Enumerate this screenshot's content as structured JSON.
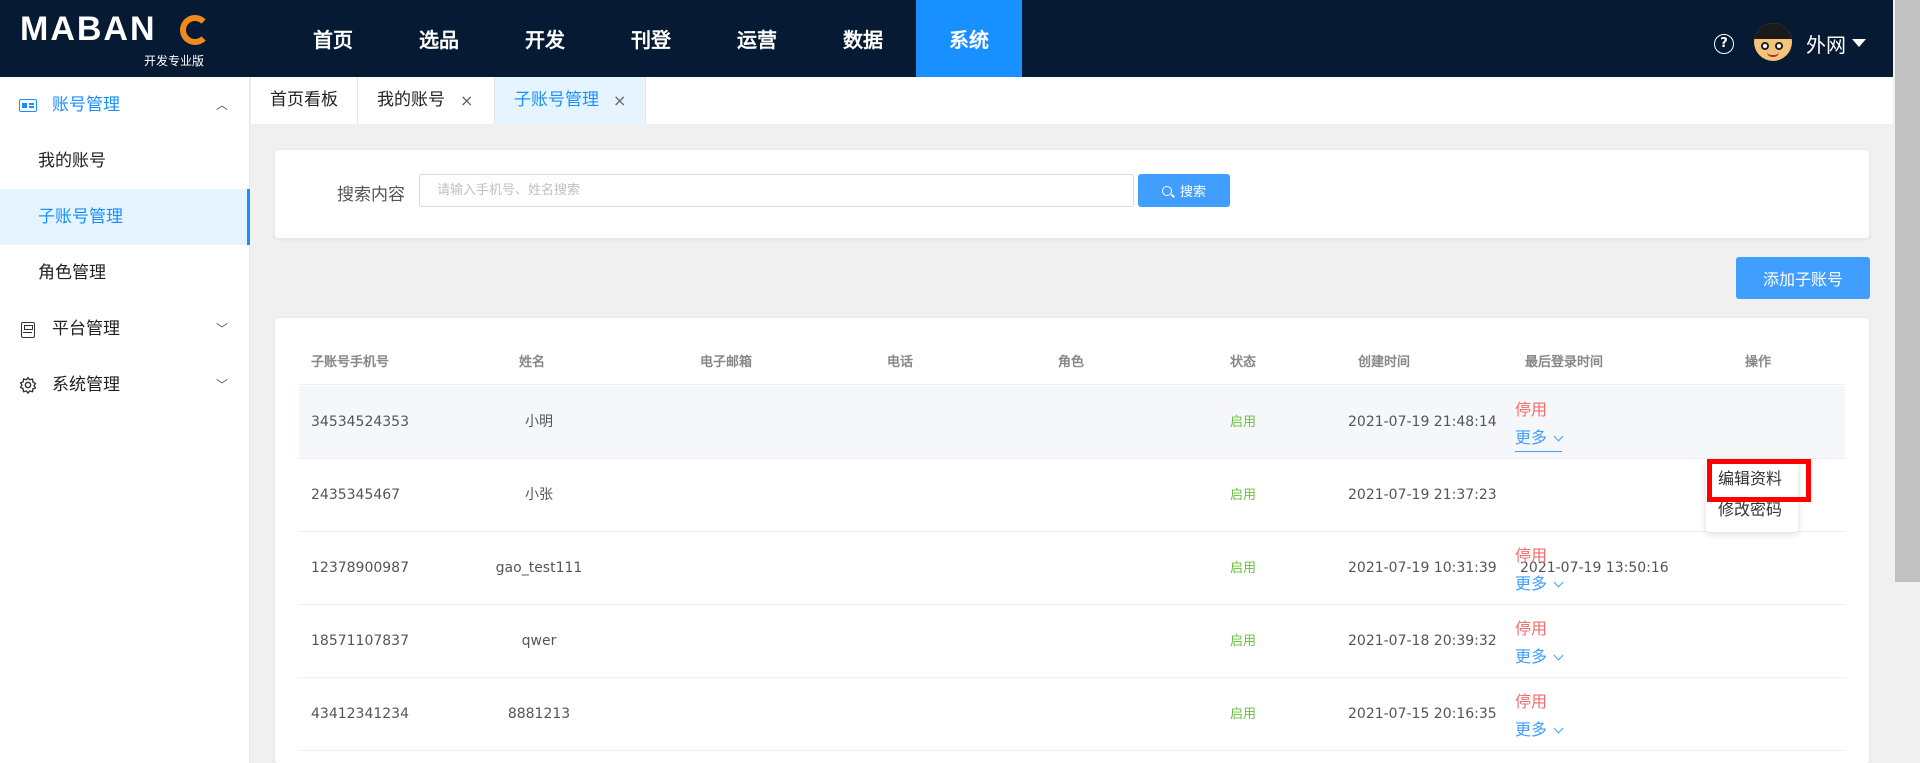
{
  "header": {
    "logo_text": "MABANG",
    "logo_subtitle": "开发专业版",
    "nav": [
      {
        "label": "首页"
      },
      {
        "label": "选品"
      },
      {
        "label": "开发"
      },
      {
        "label": "刊登"
      },
      {
        "label": "运营"
      },
      {
        "label": "数据"
      },
      {
        "label": "系统",
        "active": true
      }
    ],
    "help_icon": "question-circle-icon",
    "user_name": "外网"
  },
  "sidebar": {
    "groups": [
      {
        "label": "账号管理",
        "icon": "id-card-icon",
        "open": true,
        "items": [
          {
            "label": "我的账号"
          },
          {
            "label": "子账号管理",
            "active": true
          },
          {
            "label": "角色管理"
          }
        ]
      },
      {
        "label": "平台管理",
        "icon": "calculator-icon",
        "open": false
      },
      {
        "label": "系统管理",
        "icon": "gear-icon",
        "open": false
      }
    ]
  },
  "tabs": [
    {
      "label": "首页看板"
    },
    {
      "label": "我的账号",
      "closable": true
    },
    {
      "label": "子账号管理",
      "closable": true,
      "active": true
    }
  ],
  "search": {
    "label": "搜索内容",
    "placeholder": "请输入手机号、姓名搜索",
    "button_label": "搜索"
  },
  "add_button_label": "添加子账号",
  "table": {
    "columns": [
      "子账号手机号",
      "姓名",
      "电子邮箱",
      "电话",
      "角色",
      "状态",
      "创建时间",
      "最后登录时间",
      "操作"
    ],
    "rows": [
      {
        "phone": "34534524353",
        "name": "小明",
        "email": "",
        "tel": "",
        "role": "",
        "status": "启用",
        "created": "2021-07-19 21:48:14",
        "last_login": "",
        "stop": "停用",
        "more": "更多"
      },
      {
        "phone": "2435345467",
        "name": "小张",
        "email": "",
        "tel": "",
        "role": "",
        "status": "启用",
        "created": "2021-07-19 21:37:23",
        "last_login": "",
        "stop": "停用",
        "more": "更多"
      },
      {
        "phone": "12378900987",
        "name": "gao_test111",
        "email": "",
        "tel": "",
        "role": "",
        "status": "启用",
        "created": "2021-07-19 10:31:39",
        "last_login": "2021-07-19 13:50:16",
        "stop": "停用",
        "more": "更多"
      },
      {
        "phone": "18571107837",
        "name": "qwer",
        "email": "",
        "tel": "",
        "role": "",
        "status": "启用",
        "created": "2021-07-18 20:39:32",
        "last_login": "",
        "stop": "停用",
        "more": "更多"
      },
      {
        "phone": "43412341234",
        "name": "8881213",
        "email": "",
        "tel": "",
        "role": "",
        "status": "启用",
        "created": "2021-07-15 20:16:35",
        "last_login": "",
        "stop": "停用",
        "more": "更多"
      }
    ]
  },
  "dropdown": {
    "items": [
      "编辑资料",
      "修改密码"
    ],
    "highlighted": "编辑资料",
    "highlight_color": "#ff0000"
  },
  "colors": {
    "nav_bg": "#061a33",
    "accent": "#1890ff",
    "stop": "#f56c6c",
    "status_enabled": "#67c23a"
  }
}
